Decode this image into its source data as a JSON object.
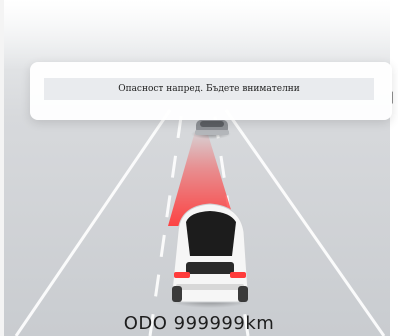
{
  "alert": {
    "message": "Опасност напред. Бъдете внимателни"
  },
  "odometer": {
    "label": "ODO",
    "value": "999999",
    "unit": "km"
  },
  "colors": {
    "warning": "#ff3b3b",
    "road": "#c8cbcf",
    "ego_car": "#f6f6f6",
    "roof": "#1c1c1c"
  }
}
